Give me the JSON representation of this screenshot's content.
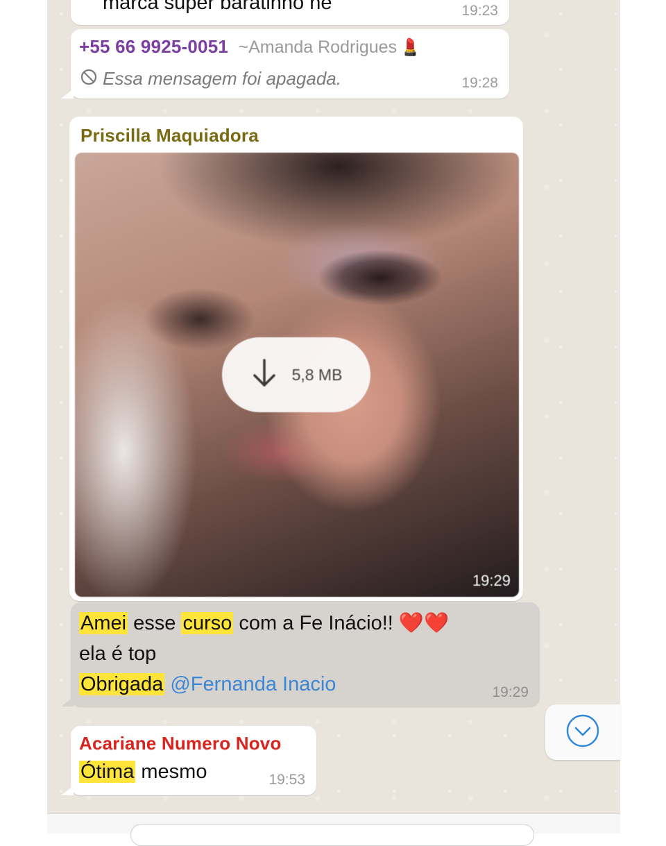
{
  "chat": {
    "messages": [
      {
        "partial_text": "marca super baratinho né",
        "time": "19:23"
      },
      {
        "sender_phone": "+55 66 9925-0051",
        "sender_name": "~Amanda Rodrigues",
        "sender_emoji": "💄",
        "deleted_text": "Essa mensagem foi apagada.",
        "time": "19:28"
      },
      {
        "sender": "Priscilla Maquiadora",
        "download_size": "5,8 MB",
        "time": "19:29"
      },
      {
        "segments": [
          "Amei",
          " esse ",
          "curso",
          " com a Fe Inácio!! "
        ],
        "emojis": "❤️❤️",
        "line2": "ela é top",
        "line3_highlight": "Obrigada",
        "mention": "@Fernanda Inacio",
        "time": "19:29"
      },
      {
        "sender": "Acariane Numero Novo",
        "highlight": "Ótima",
        "rest": " mesmo",
        "time": "19:53"
      }
    ]
  },
  "colors": {
    "sender_purple": "#7b3fa3",
    "sender_olive": "#7a6a12",
    "sender_red": "#d8241e",
    "highlight": "#ffe43a",
    "mention": "#3b86d6"
  },
  "icons": [
    "no-entry-icon",
    "download-arrow-icon",
    "chevron-down-icon",
    "lipstick-emoji",
    "heart-emoji"
  ]
}
